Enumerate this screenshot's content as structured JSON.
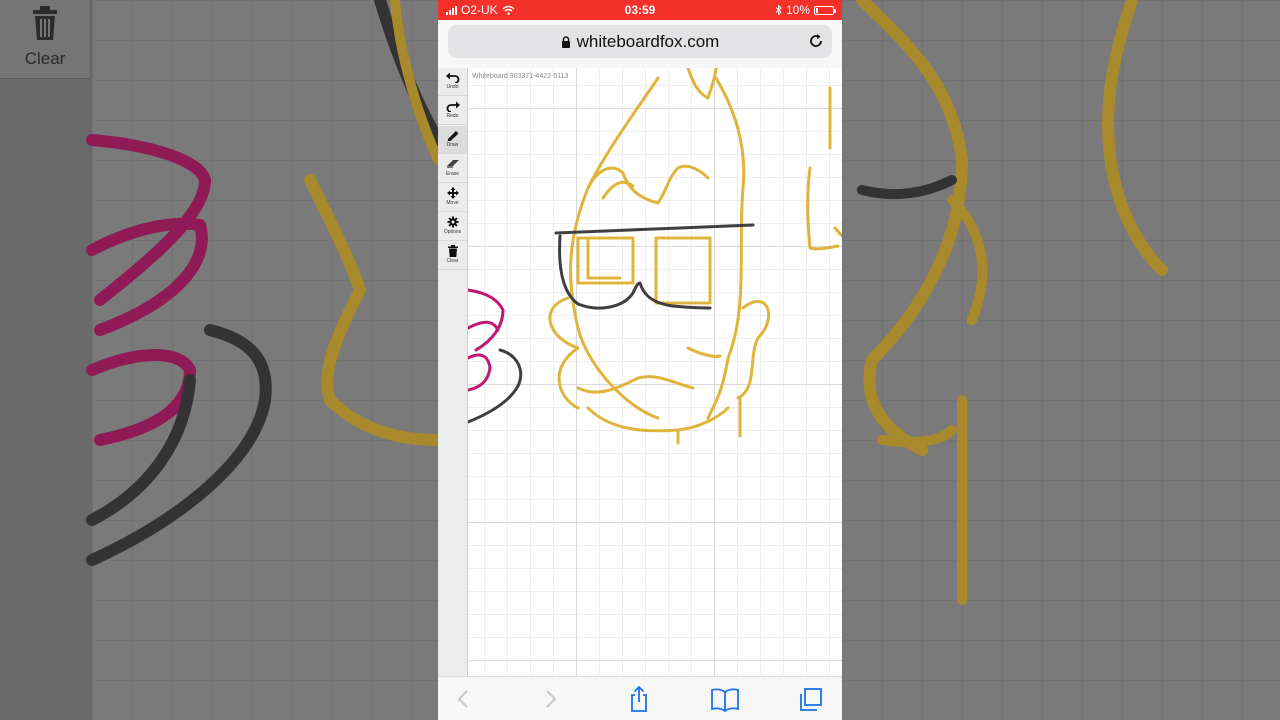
{
  "background": {
    "clear_label": "Clear"
  },
  "status_bar": {
    "carrier": "O2-UK",
    "time": "03:59",
    "battery": "10%",
    "color": "#f4302a"
  },
  "browser": {
    "url": "whiteboardfox.com"
  },
  "whiteboard": {
    "board_id": "Whiteboard 903371-4422-5113",
    "stroke_colors": {
      "yellow": "#e0b43a",
      "dark": "#3f3f3f",
      "magenta": "#c0186e"
    }
  },
  "toolbar": {
    "items": [
      {
        "label": "Undo",
        "icon": "undo-icon"
      },
      {
        "label": "Redo",
        "icon": "redo-icon"
      },
      {
        "label": "Draw",
        "icon": "pencil-icon"
      },
      {
        "label": "Erase",
        "icon": "eraser-icon"
      },
      {
        "label": "Move",
        "icon": "move-icon"
      },
      {
        "label": "Options",
        "icon": "gear-icon"
      },
      {
        "label": "Clear",
        "icon": "trash-icon"
      }
    ]
  },
  "bottom_bar": {
    "icons": [
      "back-icon",
      "forward-icon",
      "share-icon",
      "bookmarks-icon",
      "tabs-icon"
    ]
  }
}
